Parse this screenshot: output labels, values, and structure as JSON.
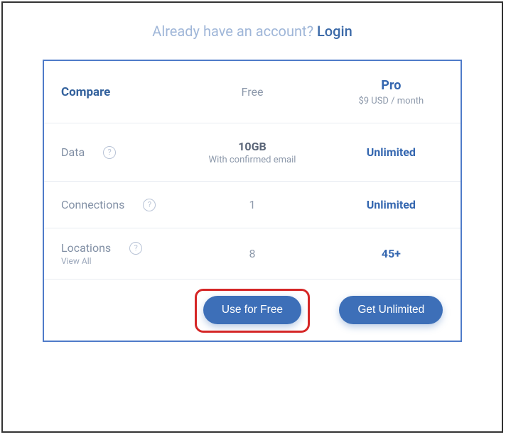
{
  "login_prompt": "Already have an account? ",
  "login_link": "Login",
  "headers": {
    "compare": "Compare",
    "free": "Free",
    "pro": "Pro",
    "pro_price": "$9 USD / month"
  },
  "rows": {
    "data": {
      "label": "Data",
      "free_value": "10GB",
      "free_sub": "With confirmed email",
      "pro_value": "Unlimited"
    },
    "connections": {
      "label": "Connections",
      "free_value": "1",
      "pro_value": "Unlimited"
    },
    "locations": {
      "label": "Locations",
      "view_all": "View All",
      "free_value": "8",
      "pro_value": "45+"
    }
  },
  "cta": {
    "free": "Use for Free",
    "pro": "Get Unlimited"
  },
  "help_glyph": "?"
}
